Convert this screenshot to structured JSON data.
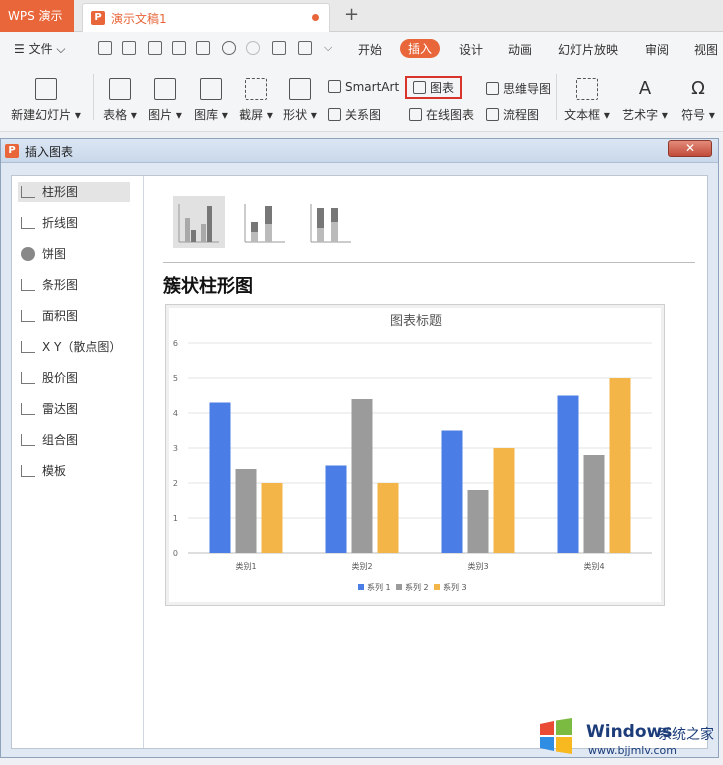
{
  "titlebar": {
    "app_name": "WPS 演示",
    "doc_title": "演示文稿1",
    "new_tab": "+"
  },
  "menubar": {
    "file": "☰ 文件 ⌵",
    "tabs": [
      "开始",
      "插入",
      "设计",
      "动画",
      "幻灯片放映",
      "审阅",
      "视图"
    ],
    "active_tab": "插入"
  },
  "ribbon": {
    "new_slide": "新建幻灯片 ▾",
    "table": "表格 ▾",
    "picture": "图片 ▾",
    "gallery": "图库 ▾",
    "screenshot": "截屏 ▾",
    "shape": "形状 ▾",
    "smartart": "SmartArt",
    "chart": "图表",
    "relation": "关系图",
    "online_chart": "在线图表",
    "mindmap": "思维导图",
    "flowchart": "流程图",
    "textbox": "文本框 ▾",
    "wordart": "艺术字 ▾",
    "symbol": "符号 ▾"
  },
  "dialog": {
    "title": "插入图表",
    "close": "✕",
    "categories": [
      "柱形图",
      "折线图",
      "饼图",
      "条形图",
      "面积图",
      "X Y（散点图）",
      "股价图",
      "雷达图",
      "组合图",
      "模板"
    ],
    "selected_category": "柱形图",
    "subtype_title": "簇状柱形图"
  },
  "chart_data": {
    "type": "bar",
    "title": "图表标题",
    "categories": [
      "类别1",
      "类别2",
      "类别3",
      "类别4"
    ],
    "series": [
      {
        "name": "系列 1",
        "values": [
          4.3,
          2.5,
          3.5,
          4.5
        ]
      },
      {
        "name": "系列 2",
        "values": [
          2.4,
          4.4,
          1.8,
          2.8
        ]
      },
      {
        "name": "系列 3",
        "values": [
          2.0,
          2.0,
          3.0,
          5.0
        ]
      }
    ],
    "ylim": [
      0,
      6
    ],
    "yticks": [
      "0",
      "1",
      "2",
      "3",
      "4",
      "5",
      "6"
    ],
    "grid": true,
    "legend": "bottom",
    "colors": [
      "#4a7ee6",
      "#9b9b9b",
      "#f4b548"
    ]
  },
  "watermark": {
    "brand": "Windows",
    "cn": "系统之家",
    "url": "www.bjjmlv.com"
  }
}
